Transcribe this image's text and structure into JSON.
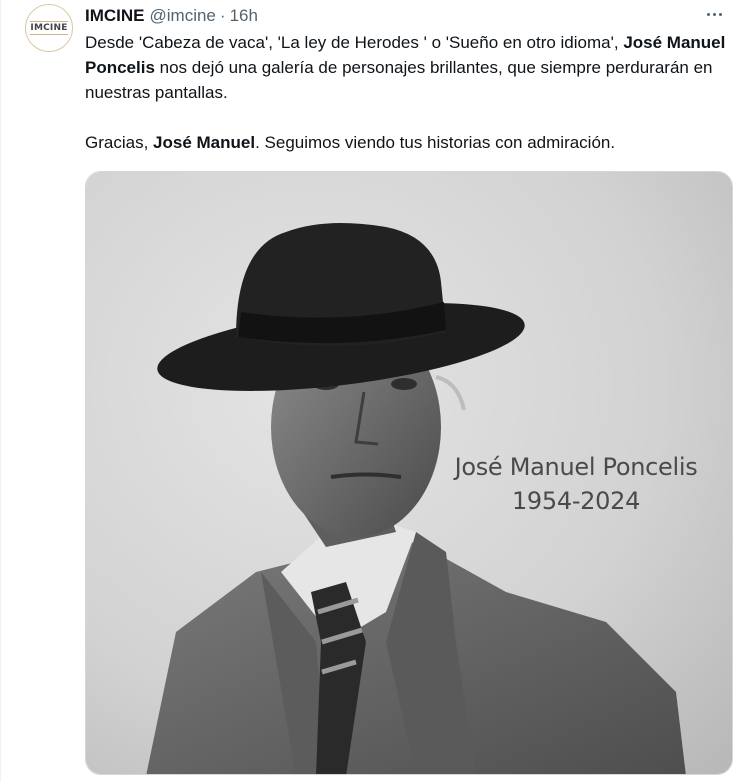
{
  "tweet": {
    "display_name": "IMCINE",
    "handle": "@imcine",
    "separator": "·",
    "time": "16h",
    "avatar_text": "IMCINE",
    "text": {
      "p1_a": "Desde 'Cabeza de vaca', 'La ley de Herodes ' o 'Sueño en otro idioma', ",
      "p1_b": "José Manuel Poncelis",
      "p1_c": " nos dejó una galería de personajes brillantes, que siempre perdurarán en nuestras pantallas.",
      "p2_a": "Gracias, ",
      "p2_b": "José Manuel",
      "p2_c": ".  Seguimos viendo tus historias con admiración."
    },
    "media": {
      "overlay_name": "José Manuel Poncelis",
      "overlay_years": "1954-2024"
    }
  },
  "icons": {
    "more": "more-horizontal-icon"
  }
}
